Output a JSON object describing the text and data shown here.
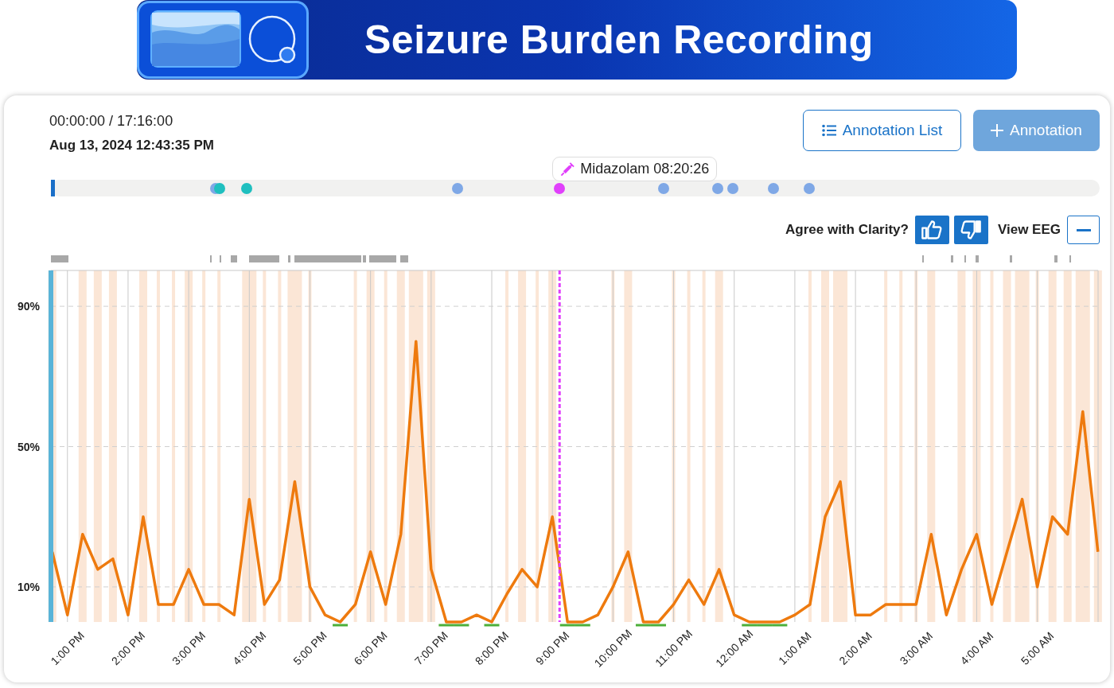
{
  "header": {
    "title": "Seizure Burden Recording"
  },
  "playback": {
    "time": "00:00:00 / 17:16:00",
    "date": "Aug 13, 2024 12:43:35 PM"
  },
  "buttons": [
    {
      "label": "Annotation List",
      "kind": "list"
    },
    {
      "label": "Annotation",
      "kind": "add"
    }
  ],
  "timeline": {
    "level": 0,
    "markers": [
      {
        "level": 0.157,
        "color": "#7fa8e6"
      },
      {
        "level": 0.161,
        "color": "#1fbfbf"
      },
      {
        "level": 0.187,
        "color": "#1fbfbf"
      },
      {
        "level": 0.388,
        "color": "#7fa8e6"
      },
      {
        "level": 0.485,
        "color": "#e040fb",
        "label": "Midazolam 08:20:26"
      },
      {
        "level": 0.584,
        "color": "#7fa8e6"
      },
      {
        "level": 0.636,
        "color": "#7fa8e6"
      },
      {
        "level": 0.65,
        "color": "#7fa8e6"
      },
      {
        "level": 0.689,
        "color": "#7fa8e6"
      },
      {
        "level": 0.723,
        "color": "#7fa8e6"
      }
    ]
  },
  "review": {
    "question": "Agree with Clarity?",
    "view_label": "View EEG",
    "view_expanded": true
  },
  "chart_data": {
    "type": "line",
    "grid": true,
    "ylim": [
      0,
      100
    ],
    "yticks": [
      {
        "value": 10,
        "label": "10%"
      },
      {
        "value": 50,
        "label": "50%"
      },
      {
        "value": 90,
        "label": "90%"
      }
    ],
    "categories": [
      null,
      "1:00 PM",
      null,
      null,
      null,
      "2:00 PM",
      null,
      null,
      null,
      "3:00 PM",
      null,
      null,
      null,
      "4:00 PM",
      null,
      null,
      null,
      "5:00 PM",
      null,
      null,
      null,
      "6:00 PM",
      null,
      null,
      null,
      "7:00 PM",
      null,
      null,
      null,
      "8:00 PM",
      null,
      null,
      null,
      "9:00 PM",
      null,
      null,
      null,
      "10:00 PM",
      null,
      null,
      null,
      "11:00 PM",
      null,
      null,
      null,
      "12:00 AM",
      null,
      null,
      null,
      "1:00 AM",
      null,
      null,
      null,
      "2:00 AM",
      null,
      null,
      null,
      "3:00 AM",
      null,
      null,
      null,
      "4:00 AM",
      null,
      null,
      null,
      "5:00 AM",
      null,
      null,
      null,
      null
    ],
    "series": [
      {
        "color": "#ee7a0e",
        "values": [
          20,
          2,
          25,
          15,
          18,
          2,
          30,
          5,
          5,
          15,
          5,
          5,
          2,
          35,
          5,
          12,
          40,
          10,
          2,
          0,
          5,
          20,
          5,
          25,
          80,
          15,
          0,
          0,
          2,
          0,
          8,
          15,
          10,
          30,
          0,
          0,
          2,
          10,
          20,
          0,
          0,
          5,
          12,
          5,
          15,
          2,
          0,
          0,
          0,
          2,
          5,
          30,
          40,
          2,
          2,
          5,
          5,
          5,
          25,
          2,
          15,
          25,
          5,
          20,
          35,
          10,
          30,
          25,
          60,
          20
        ]
      }
    ]
  }
}
